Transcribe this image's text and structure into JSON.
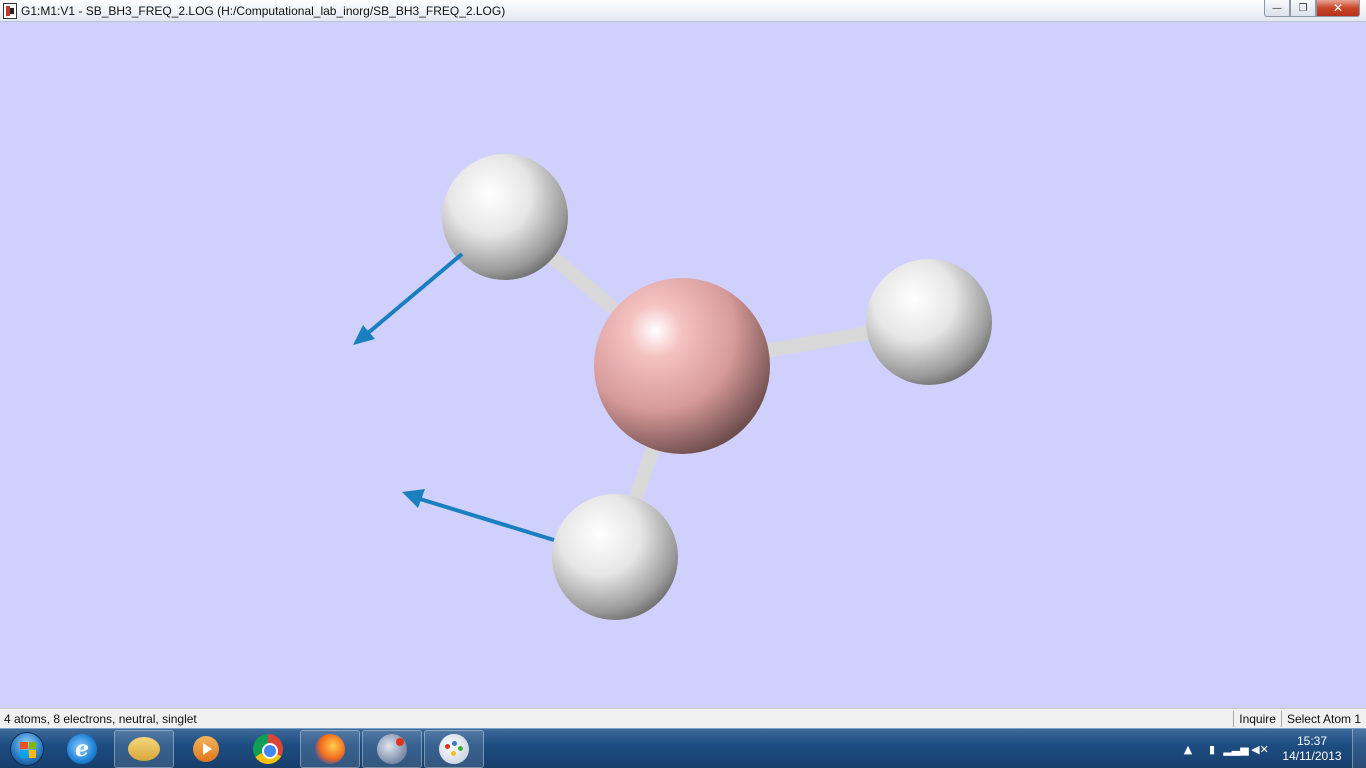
{
  "window": {
    "title": "G1:M1:V1 - SB_BH3_FREQ_2.LOG (H:/Computational_lab_inorg/SB_BH3_FREQ_2.LOG)",
    "controls": {
      "minimize": "—",
      "maximize": "❐",
      "close": "✕"
    }
  },
  "molecule": {
    "atoms": [
      {
        "element": "B",
        "color": "#e8a8a8"
      },
      {
        "element": "H",
        "color": "#ffffff"
      },
      {
        "element": "H",
        "color": "#ffffff"
      },
      {
        "element": "H",
        "color": "#ffffff"
      }
    ],
    "background_color": "#d0d0fc",
    "displacement_vector_color": "#1a7fbf",
    "bond_color": "#f0f0f0"
  },
  "status": {
    "info": "4 atoms, 8 electrons, neutral, singlet",
    "mode": "Inquire",
    "selection": "Select Atom 1"
  },
  "taskbar": {
    "start_icon": "windows-start-orb",
    "items": [
      {
        "name": "internet-explorer-icon",
        "glyph": "e"
      },
      {
        "name": "file-explorer-icon",
        "glyph": ""
      },
      {
        "name": "media-player-icon",
        "glyph": ""
      },
      {
        "name": "chrome-icon",
        "glyph": ""
      },
      {
        "name": "firefox-icon",
        "glyph": ""
      },
      {
        "name": "gaussview-icon",
        "glyph": ""
      },
      {
        "name": "paint-icon",
        "glyph": ""
      }
    ],
    "tray": {
      "arrow": "▲",
      "time": "15:37",
      "date": "14/11/2013"
    }
  }
}
